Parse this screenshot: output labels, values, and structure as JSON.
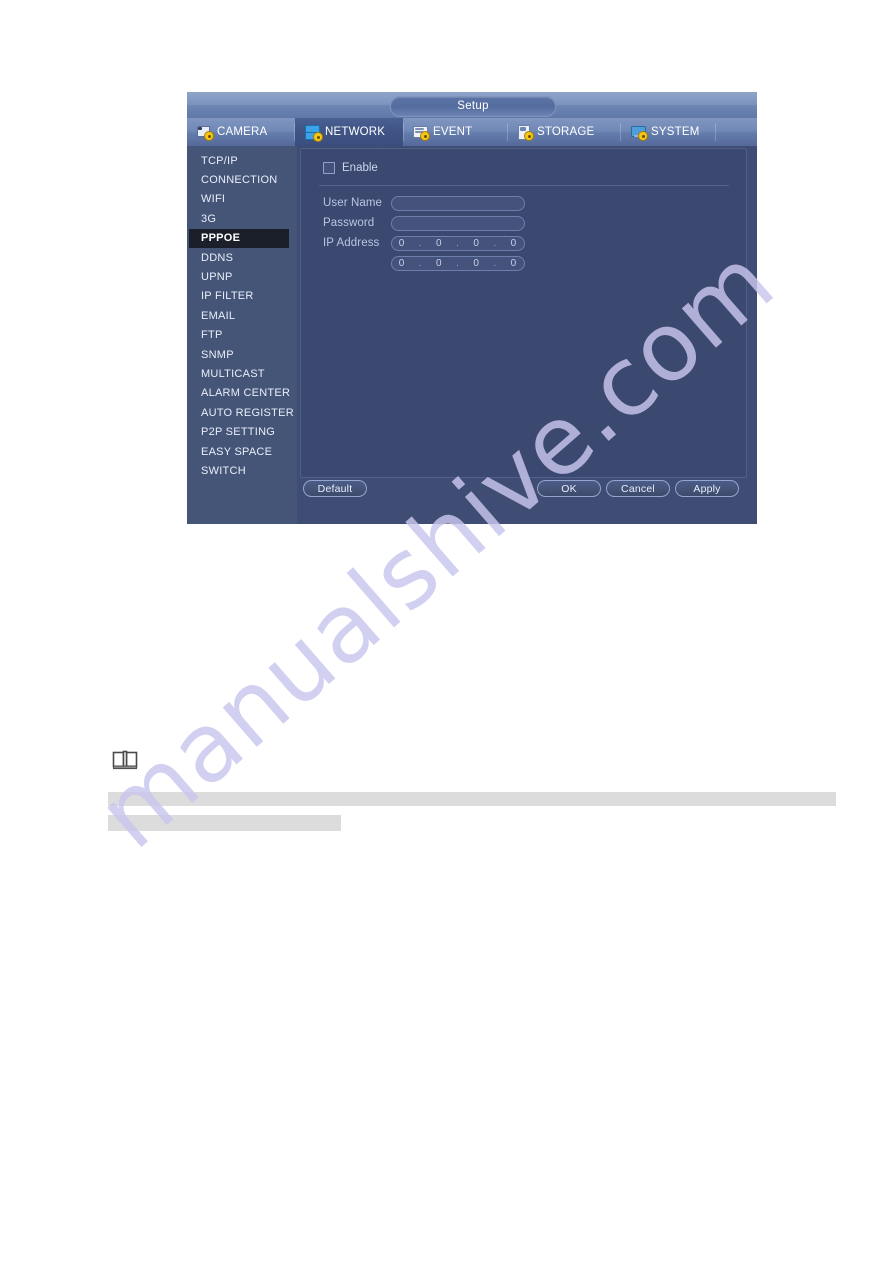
{
  "window": {
    "title": "Setup"
  },
  "tabs": [
    {
      "label": "CAMERA",
      "icon": "camera-gear-icon",
      "active": false
    },
    {
      "label": "NETWORK",
      "icon": "network-gear-icon",
      "active": true
    },
    {
      "label": "EVENT",
      "icon": "event-gear-icon",
      "active": false
    },
    {
      "label": "STORAGE",
      "icon": "storage-gear-icon",
      "active": false
    },
    {
      "label": "SYSTEM",
      "icon": "system-gear-icon",
      "active": false
    }
  ],
  "sidebar": {
    "items": [
      {
        "label": "TCP/IP",
        "selected": false
      },
      {
        "label": "CONNECTION",
        "selected": false
      },
      {
        "label": "WIFI",
        "selected": false
      },
      {
        "label": "3G",
        "selected": false
      },
      {
        "label": "PPPOE",
        "selected": true
      },
      {
        "label": "DDNS",
        "selected": false
      },
      {
        "label": "UPNP",
        "selected": false
      },
      {
        "label": "IP FILTER",
        "selected": false
      },
      {
        "label": "EMAIL",
        "selected": false
      },
      {
        "label": "FTP",
        "selected": false
      },
      {
        "label": "SNMP",
        "selected": false
      },
      {
        "label": "MULTICAST",
        "selected": false
      },
      {
        "label": "ALARM CENTER",
        "selected": false
      },
      {
        "label": "AUTO REGISTER",
        "selected": false
      },
      {
        "label": "P2P SETTING",
        "selected": false
      },
      {
        "label": "EASY SPACE",
        "selected": false
      },
      {
        "label": "SWITCH",
        "selected": false
      }
    ]
  },
  "form": {
    "enable": {
      "label": "Enable",
      "checked": false
    },
    "user_name": {
      "label": "User Name",
      "value": "",
      "placeholder": ""
    },
    "password": {
      "label": "Password",
      "value": "",
      "placeholder": ""
    },
    "ip_address": {
      "label": "IP Address",
      "row1": {
        "o1": "0",
        "o2": "0",
        "o3": "0",
        "o4": "0"
      },
      "row2": {
        "o1": "0",
        "o2": "0",
        "o3": "0",
        "o4": "0"
      },
      "separator": "."
    }
  },
  "buttons": {
    "default_label": "Default",
    "ok_label": "OK",
    "cancel_label": "Cancel",
    "apply_label": "Apply"
  },
  "note": {
    "icon": "open-book-icon"
  },
  "watermark": {
    "text": "manualshive.com"
  },
  "colors": {
    "dialog_bg": "#3f4d74",
    "sidebar_bg": "#455578",
    "panel_bg": "#3b4870",
    "selected_item_bg": "#1b1f29",
    "title_bar": "#7d94be",
    "accent_gear": "#f5c518",
    "redact_gray": "#dcdcdc",
    "watermark": "#c9c6ef"
  }
}
